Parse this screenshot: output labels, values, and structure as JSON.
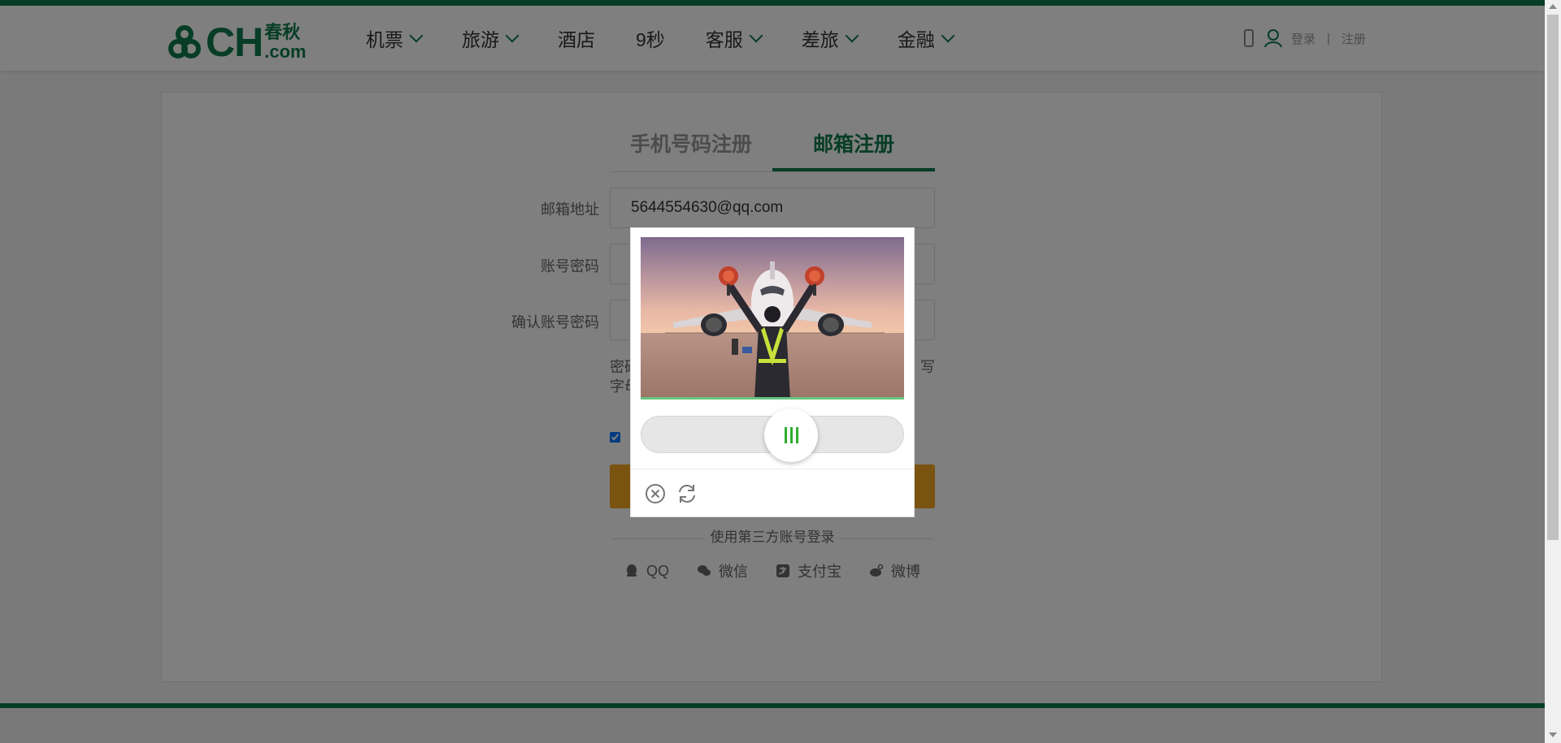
{
  "header": {
    "logo": {
      "latin": "CH",
      "cn_top": "春秋",
      "cn_bottom": ".com"
    },
    "nav": [
      {
        "label": "机票",
        "dropdown": true
      },
      {
        "label": "旅游",
        "dropdown": true
      },
      {
        "label": "酒店",
        "dropdown": false
      },
      {
        "label": "9秒",
        "dropdown": false
      },
      {
        "label": "客服",
        "dropdown": true
      },
      {
        "label": "差旅",
        "dropdown": true
      },
      {
        "label": "金融",
        "dropdown": true
      }
    ],
    "login": "登录",
    "separator": "|",
    "register": "注册"
  },
  "tabs": {
    "phone": "手机号码注册",
    "email": "邮箱注册"
  },
  "form": {
    "email_label": "邮箱地址",
    "email_value": "5644554630@qq.com",
    "password_label": "账号密码",
    "confirm_label": "确认账号密码",
    "hint_line1_start": "密码",
    "hint_line1_end": "写",
    "hint_line2_start": "字母"
  },
  "third_party": {
    "title": "使用第三方账号登录",
    "items": [
      "QQ",
      "微信",
      "支付宝",
      "微博"
    ]
  },
  "captcha": {
    "slider_progress": 0.5
  },
  "colors": {
    "brand": "#0f7a4e",
    "submit": "#f5a623",
    "slider_grip": "#2fae2f"
  }
}
